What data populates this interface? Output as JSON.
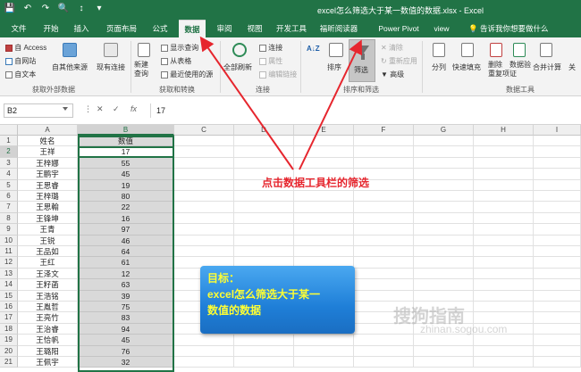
{
  "window": {
    "title": "excel怎么筛选大于某一数值的数据.xlsx  -  Excel",
    "qat_icons": [
      "save-icon",
      "undo-icon",
      "redo-icon",
      "print-preview-icon",
      "sort-icon",
      "customize-qat-icon"
    ]
  },
  "tabs": [
    {
      "label": "文件"
    },
    {
      "label": "开始"
    },
    {
      "label": "插入"
    },
    {
      "label": "页面布局"
    },
    {
      "label": "公式"
    },
    {
      "label": "数据"
    },
    {
      "label": "审阅"
    },
    {
      "label": "视图"
    },
    {
      "label": "开发工具"
    },
    {
      "label": "福昕阅读器"
    },
    {
      "label": "Power Pivot"
    },
    {
      "label": "view"
    }
  ],
  "tell_me": "告诉我你想要做什么",
  "ribbon": {
    "get_external": {
      "access": "自 Access",
      "web": "自网站",
      "text": "自文本",
      "other": "自其他来源",
      "existing": "现有连接",
      "label": "获取外部数据"
    },
    "get_transform": {
      "new_query": "新建\n查询",
      "show_queries": "显示查询",
      "from_table": "从表格",
      "recent_sources": "最近使用的源",
      "label": "获取和转换"
    },
    "connections": {
      "refresh_all": "全部刷新",
      "connections": "连接",
      "properties": "属性",
      "edit_links": "编辑链接",
      "label": "连接"
    },
    "sort_filter": {
      "sort_az": "A↓Z",
      "sort": "排序",
      "filter": "筛选",
      "clear": "清除",
      "reapply": "重新应用",
      "advanced": "高级",
      "label": "排序和筛选"
    },
    "data_tools": {
      "text_to_columns": "分列",
      "flash_fill": "快速填充",
      "remove_duplicates": "删除\n重复项",
      "data_validation": "数据验\n证",
      "consolidate": "合并计算",
      "relationships": "关",
      "label": "数据工具"
    }
  },
  "formula_bar": {
    "name_box": "B2",
    "cancel": "✕",
    "enter": "✓",
    "fx": "fx",
    "value": "17"
  },
  "columns": [
    "A",
    "B",
    "C",
    "D",
    "E",
    "F",
    "G",
    "H",
    "I"
  ],
  "header_row": {
    "name": "姓名",
    "value": "数值"
  },
  "rows": [
    {
      "n": "1"
    },
    {
      "n": "2",
      "name": "王祥",
      "value": "17"
    },
    {
      "n": "3",
      "name": "王梓娜",
      "value": "55"
    },
    {
      "n": "4",
      "name": "王鹏宇",
      "value": "45"
    },
    {
      "n": "5",
      "name": "王思睿",
      "value": "19"
    },
    {
      "n": "6",
      "name": "王梓璐",
      "value": "80"
    },
    {
      "n": "7",
      "name": "王思翰",
      "value": "22"
    },
    {
      "n": "8",
      "name": "王锋坤",
      "value": "16"
    },
    {
      "n": "9",
      "name": "王青",
      "value": "97"
    },
    {
      "n": "10",
      "name": "王锐",
      "value": "46"
    },
    {
      "n": "11",
      "name": "王品如",
      "value": "64"
    },
    {
      "n": "12",
      "name": "王红",
      "value": "61"
    },
    {
      "n": "13",
      "name": "王泽文",
      "value": "12"
    },
    {
      "n": "14",
      "name": "王籽菡",
      "value": "63"
    },
    {
      "n": "15",
      "name": "王浩铭",
      "value": "39"
    },
    {
      "n": "16",
      "name": "王胤哲",
      "value": "75"
    },
    {
      "n": "17",
      "name": "王亮竹",
      "value": "83"
    },
    {
      "n": "18",
      "name": "王治睿",
      "value": "94"
    },
    {
      "n": "19",
      "name": "王恰帆",
      "value": "45"
    },
    {
      "n": "20",
      "name": "王璐阳",
      "value": "76"
    },
    {
      "n": "21",
      "name": "王佩宇",
      "value": "32"
    }
  ],
  "annotation": {
    "callout": "点击数据工具栏的筛选",
    "goal_lines": [
      "目标：",
      "excel怎么筛选大于某一",
      "数值的数据"
    ],
    "arrow_color": "#e6262e",
    "box_color": "#1f7fd8",
    "text_color": "#ffff33"
  },
  "watermark": {
    "main": "搜狗指南",
    "sub": "zhinan.sogou.com"
  },
  "colors": {
    "brand": "#217346",
    "ribbon_bg": "#f3f3f3",
    "selected_fill": "#d9d9d9"
  }
}
